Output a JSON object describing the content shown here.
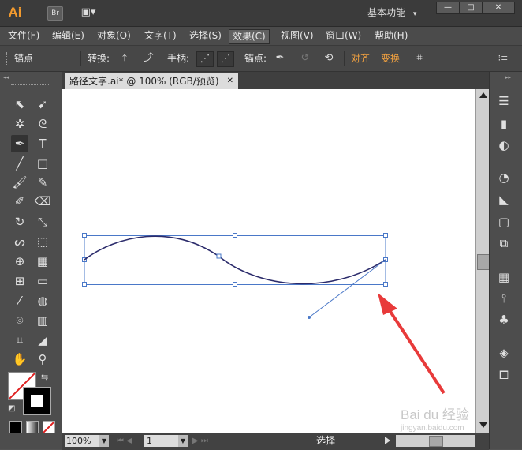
{
  "app": {
    "logo": "Ai",
    "bridge": "Br",
    "arrange": "▣▾",
    "workspace": "基本功能",
    "workspace_arrow": "▾"
  },
  "window_controls": {
    "minimize": "—",
    "maximize": "□",
    "close": "✕"
  },
  "menu": {
    "items": [
      "文件(F)",
      "编辑(E)",
      "对象(O)",
      "文字(T)",
      "选择(S)",
      "效果(C)",
      "视图(V)",
      "窗口(W)",
      "帮助(H)"
    ],
    "active_index": 5
  },
  "control_bar": {
    "object_type": "锚点",
    "convert_label": "转换:",
    "handles_label": "手柄:",
    "anchor_label": "锚点:",
    "align_link": "对齐",
    "transform_link": "变换",
    "menu_glyph": "⁝≡"
  },
  "document": {
    "tab_title": "路径文字.ai* @ 100% (RGB/预览)",
    "tab_close": "✕"
  },
  "status": {
    "zoom": "100%",
    "page": "1",
    "tool_name": "选择"
  },
  "watermark": {
    "brand": "Bai du 经验",
    "url": "jingyan.baidu.com"
  },
  "colors": {
    "accent_orange": "#f0a040",
    "path_stroke": "#2b2b6b",
    "bbox": "#4a78c8",
    "arrow": "#e83a3a"
  }
}
